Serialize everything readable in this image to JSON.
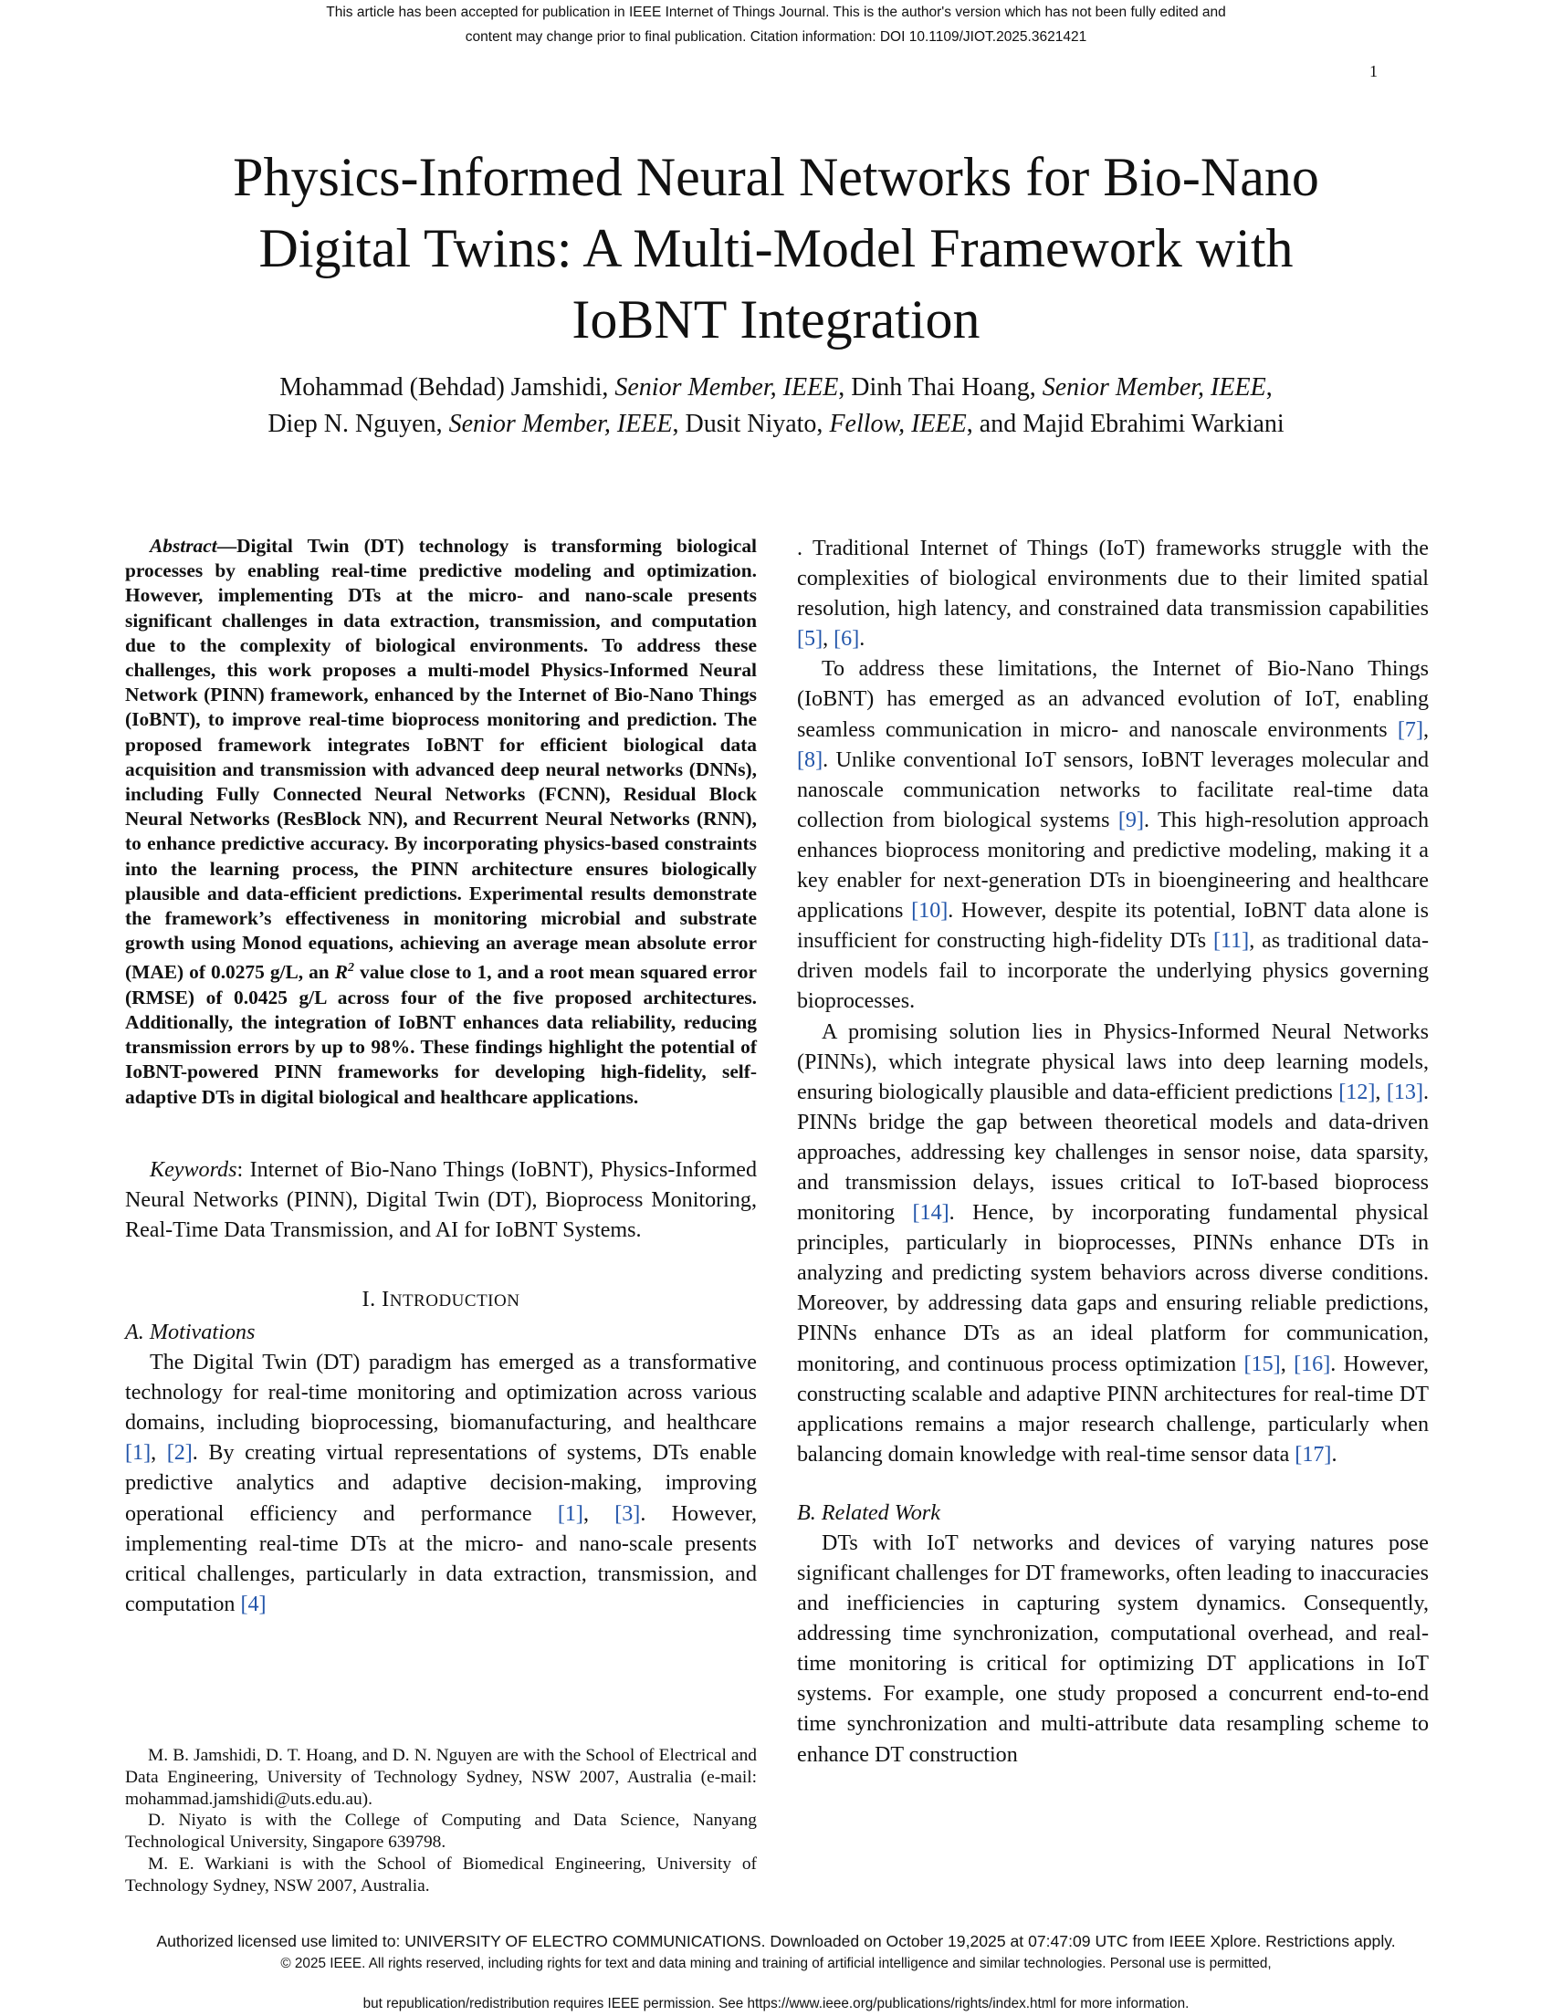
{
  "header": {
    "notice_line1": "This article has been accepted for publication in IEEE Internet of Things Journal. This is the author's version which has not been fully edited and",
    "notice_line2": "content may change prior to final publication. Citation information: DOI 10.1109/JIOT.2025.3621421",
    "page_number": "1"
  },
  "paper": {
    "title_line1": "Physics-Informed Neural Networks for Bio-Nano",
    "title_line2": "Digital Twins: A Multi-Model Framework with",
    "title_line3": "IoBNT Integration",
    "authors": {
      "a1": "Mohammad (Behdad) Jamshidi,",
      "a1_role": "Senior Member, IEEE",
      "a2": "Dinh Thai Hoang,",
      "a2_role": "Senior Member, IEEE",
      "a3": "Diep N. Nguyen,",
      "a3_role": "Senior Member, IEEE",
      "a4": "Dusit Niyato,",
      "a4_role": "Fellow, IEEE",
      "a5": "and Majid Ebrahimi Warkiani"
    }
  },
  "abstract": {
    "label": "Abstract",
    "text_before_r2": "—Digital Twin (DT) technology is transforming biological processes by enabling real-time predictive modeling and optimization. However, implementing DTs at the micro- and nano-scale presents significant challenges in data extraction, transmission, and computation due to the complexity of biological environments. To address these challenges, this work proposes a multi-model Physics-Informed Neural Network (PINN) framework, enhanced by the Internet of Bio-Nano Things (IoBNT), to improve real-time bioprocess monitoring and prediction. The proposed framework integrates IoBNT for efficient biological data acquisition and transmission with advanced deep neural networks (DNNs), including Fully Connected Neural Networks (FCNN), Residual Block Neural Networks (ResBlock NN), and Recurrent Neural Networks (RNN), to enhance predictive accuracy. By incorporating physics-based constraints into the learning process, the PINN architecture ensures biologically plausible and data-efficient predictions. Experimental results demonstrate the framework’s effectiveness in monitoring microbial and substrate growth using Monod equations, achieving an average mean absolute error (MAE) of 0.0275 g/L, an",
    "r2_symbol": "R",
    "r2_exponent": "2",
    "text_after_r2": "value close to 1, and a root mean squared error (RMSE) of 0.0425 g/L across four of the five proposed architectures. Additionally, the integration of IoBNT enhances data reliability, reducing transmission errors by up to 98%. These findings highlight the potential of IoBNT-powered PINN frameworks for developing high-fidelity, self-adaptive DTs in digital biological and healthcare applications."
  },
  "keywords": {
    "label": "Keywords",
    "text": ": Internet of Bio-Nano Things (IoBNT), Physics-Informed Neural Networks (PINN), Digital Twin (DT), Bioprocess Monitoring, Real-Time Data Transmission, and AI for IoBNT Systems."
  },
  "introduction": {
    "heading_numeral": "I. I",
    "heading_rest": "NTRODUCTION",
    "subsection_a": "A.  Motivations",
    "para1": {
      "t1": "The Digital Twin (DT) paradigm has emerged as a transformative technology for real-time monitoring and optimization across various domains, including bioprocessing, biomanufacturing, and healthcare ",
      "c1": "[1]",
      "t2": ", ",
      "c2": "[2]",
      "t3": ". By creating virtual representations of systems, DTs enable predictive analytics and adaptive decision-making, improving operational efficiency and performance ",
      "c3": "[1]",
      "t4": ", ",
      "c4": "[3]",
      "t5": ". However, implementing real-time DTs at the micro- and nano-scale presents critical challenges, particularly in data extraction, transmission, and computation ",
      "c5": "[4]",
      "t6": ". Traditional Internet of Things (IoT) frameworks struggle with the complexities of biological environments due to their limited spatial resolution, high latency, and constrained data transmission capabilities ",
      "c6": "[5]",
      "t7": ", ",
      "c7": "[6]",
      "t8": "."
    },
    "para2": {
      "t1": "To address these limitations, the Internet of Bio-Nano Things (IoBNT) has emerged as an advanced evolution of IoT, enabling seamless communication in micro- and nanoscale environments ",
      "c1": "[7]",
      "t2": ", ",
      "c2": "[8]",
      "t3": ". Unlike conventional IoT sensors, IoBNT leverages molecular and nanoscale communication networks to facilitate real-time data collection from biological systems ",
      "c3": "[9]",
      "t4": ". This high-resolution approach enhances bioprocess monitoring and predictive modeling, making it a key enabler for next-generation DTs in bioengineering and healthcare applications ",
      "c4": "[10]",
      "t5": ". However, despite its potential, IoBNT data alone is insufficient for constructing high-fidelity DTs ",
      "c5": "[11]",
      "t6": ", as traditional data-driven models fail to incorporate the underlying physics governing bioprocesses."
    },
    "para3": {
      "t1": "A promising solution lies in Physics-Informed Neural Networks (PINNs), which integrate physical laws into deep learning models, ensuring biologically plausible and data-efficient predictions ",
      "c1": "[12]",
      "t2": ", ",
      "c2": "[13]",
      "t3": ". PINNs bridge the gap between theoretical models and data-driven approaches, addressing key challenges in sensor noise, data sparsity, and transmission delays, issues critical to IoT-based bioprocess monitoring ",
      "c3": "[14]",
      "t4": ". Hence, by incorporating fundamental physical principles, particularly in bioprocesses, PINNs enhance DTs in analyzing and predicting system behaviors across diverse conditions. Moreover, by addressing data gaps and ensuring reliable predictions, PINNs enhance DTs as an ideal platform for communication, monitoring, and continuous process optimization ",
      "c4": "[15]",
      "t5": ", ",
      "c5": "[16]",
      "t6": ". However, constructing scalable and adaptive PINN architectures for real-time DT applications remains a major research challenge, particularly when balancing domain knowledge with real-time sensor data ",
      "c6": "[17]",
      "t7": "."
    },
    "subsection_b": "B.  Related Work",
    "para4": "DTs with IoT networks and devices of varying natures pose significant challenges for DT frameworks, often leading to inaccuracies and inefficiencies in capturing system dynamics. Consequently, addressing time synchronization, computational overhead, and real-time monitoring is critical for optimizing DT applications in IoT systems. For example, one study proposed a concurrent end-to-end time synchronization and multi-attribute data resampling scheme to enhance DT construction"
  },
  "footnotes": {
    "fn1": "M. B. Jamshidi, D. T. Hoang, and D. N. Nguyen are with the School of Electrical and Data Engineering, University of Technology Sydney, NSW 2007, Australia (e-mail: mohammad.jamshidi@uts.edu.au).",
    "fn2": "D. Niyato is with the College of Computing and Data Science, Nanyang Technological University, Singapore 639798.",
    "fn3": "M. E. Warkiani is with the School of Biomedical Engineering, University of Technology Sydney, NSW 2007, Australia."
  },
  "footer": {
    "license": "Authorized licensed use limited to: UNIVERSITY OF ELECTRO COMMUNICATIONS. Downloaded on October 19,2025 at 07:47:09 UTC from IEEE Xplore.  Restrictions apply.",
    "copyright": "© 2025 IEEE. All rights reserved, including rights for text and data mining and training of artificial intelligence and similar technologies. Personal use is permitted,",
    "republication": "but republication/redistribution requires IEEE permission. See https://www.ieee.org/publications/rights/index.html for more information."
  },
  "colors": {
    "citation": "#2255aa",
    "text": "#111111"
  }
}
